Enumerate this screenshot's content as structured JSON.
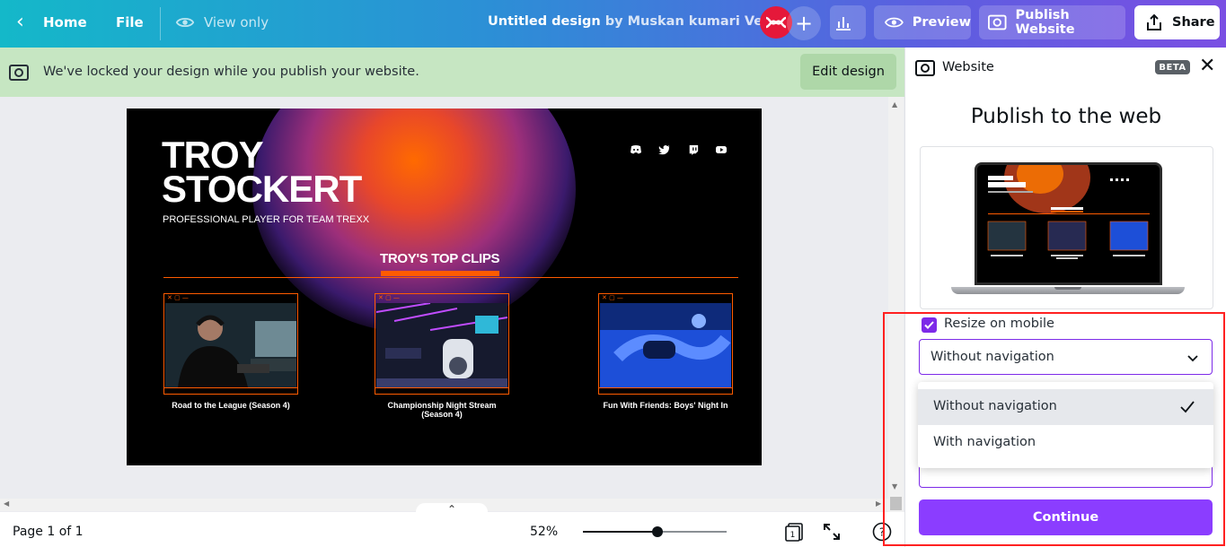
{
  "topbar": {
    "home_label": "Home",
    "file_label": "File",
    "view_only_label": "View only",
    "doc_title": "Untitled design",
    "doc_by": "by Muskan kumari Verma",
    "preview_label": "Preview",
    "publish_label": "Publish Website",
    "share_label": "Share"
  },
  "notice": {
    "text": "We've locked your design while you publish your website.",
    "edit_label": "Edit design"
  },
  "design": {
    "name_line1": "TROY",
    "name_line2": "STOCKERT",
    "subtitle": "PROFESSIONAL PLAYER FOR TEAM TREXX",
    "section_title": "TROY'S TOP CLIPS",
    "clips": [
      {
        "caption": "Road to the League (Season 4)"
      },
      {
        "caption": "Championship Night Stream (Season 4)"
      },
      {
        "caption": "Fun With Friends: Boys' Night In"
      }
    ]
  },
  "bottombar": {
    "page_info": "Page 1 of 1",
    "zoom": "52%",
    "zoom_slider_fraction": 0.52,
    "page_count": "1"
  },
  "panel": {
    "title": "Website",
    "beta": "BETA",
    "heading": "Publish to the web",
    "resize_label": "Resize on mobile",
    "resize_checked": true,
    "select_value": "Without navigation",
    "options": [
      "Without navigation",
      "With navigation"
    ],
    "continue_label": "Continue"
  },
  "colors": {
    "accent": "#7d2ae8",
    "continue": "#8b3dff",
    "notice_bg": "#c6e6c2",
    "design_orange": "#ff5b00"
  }
}
